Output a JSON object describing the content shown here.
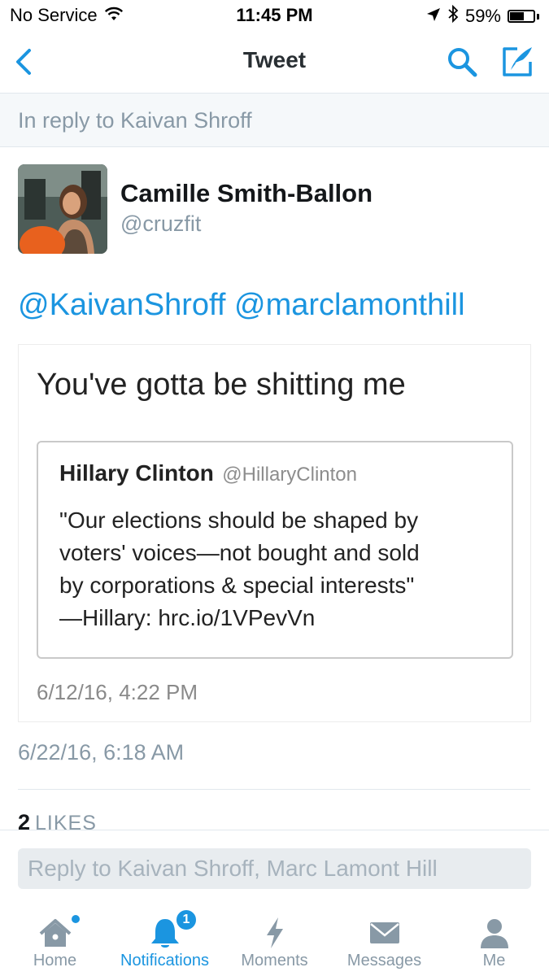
{
  "status_bar": {
    "carrier": "No Service",
    "time": "11:45 PM",
    "battery_percent": "59%",
    "battery_level": 0.59,
    "icons": [
      "wifi-icon",
      "location-arrow-icon",
      "bluetooth-icon",
      "battery-icon"
    ]
  },
  "nav": {
    "title": "Tweet",
    "icons": [
      "back-chevron-icon",
      "search-icon",
      "compose-icon"
    ]
  },
  "reply_context": "In reply to Kaivan Shroff",
  "tweet": {
    "author_name": "Camille Smith-Ballon",
    "author_handle": "@cruzfit",
    "mentions": [
      "@KaivanShroff",
      "@marclamonthill"
    ],
    "media": {
      "caption": "You've gotta be shitting me",
      "quoted_name": "Hillary Clinton",
      "quoted_handle": "@HillaryClinton",
      "quoted_lines": [
        "\"Our elections should be shaped by",
        "voters' voices—not bought and sold",
        "by corporations & special interests\"",
        "—Hillary: hrc.io/1VPevVn"
      ],
      "quoted_date": "6/12/16, 4:22 PM"
    },
    "timestamp": "6/22/16, 6:18 AM",
    "likes_count": "2",
    "likes_label": "LIKES"
  },
  "reply_box": {
    "placeholder": "Reply to Kaivan Shroff, Marc Lamont Hill"
  },
  "tabs": [
    {
      "label": "Home",
      "icon": "home-icon",
      "has_dot": true
    },
    {
      "label": "Notifications",
      "icon": "bell-icon",
      "active": true,
      "badge": "1"
    },
    {
      "label": "Moments",
      "icon": "lightning-icon"
    },
    {
      "label": "Messages",
      "icon": "envelope-icon"
    },
    {
      "label": "Me",
      "icon": "person-icon"
    }
  ],
  "colors": {
    "accent": "#1b95e0",
    "muted": "#8899a6",
    "text": "#14171a",
    "context_bg": "#f5f8fa"
  }
}
